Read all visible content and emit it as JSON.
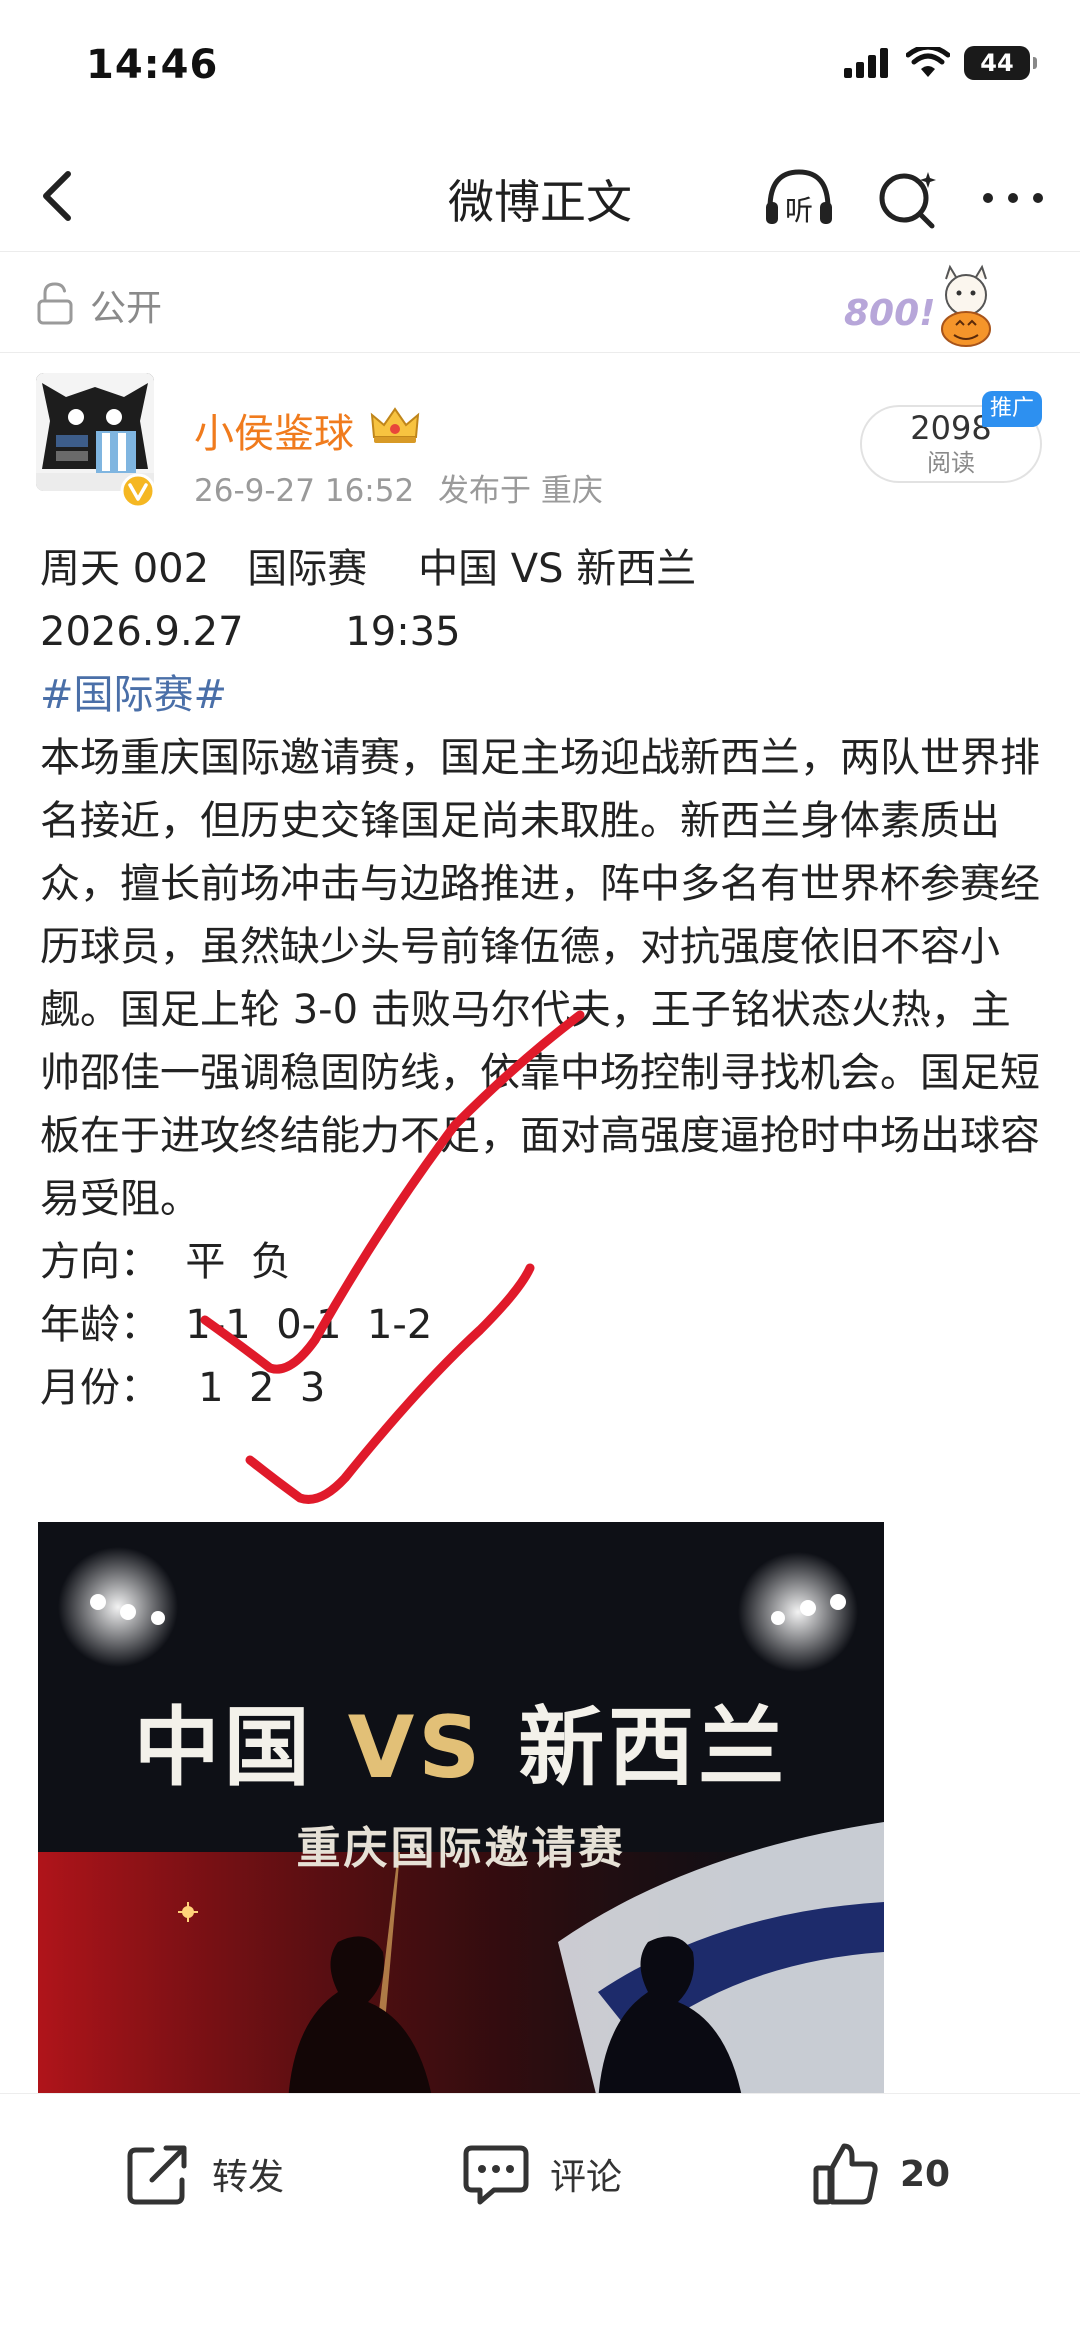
{
  "status_bar": {
    "time": "14:46",
    "battery": "44"
  },
  "nav": {
    "title": "微博正文",
    "listen_label": "听"
  },
  "visibility": {
    "label": "公开",
    "sticker_text": "800!"
  },
  "author": {
    "name": "小侯鉴球",
    "timestamp": "26-9-27 16:52",
    "location": "发布于 重庆",
    "reads_count": "2098",
    "reads_label": "阅读",
    "promo_badge": "推广"
  },
  "post": {
    "line1": "周天 002   国际赛    中国 VS 新西兰",
    "line2": "2026.9.27        19:35",
    "hashtag": "#国际赛#",
    "paragraph": "本场重庆国际邀请赛，国足主场迎战新西兰，两队世界排名接近，但历史交锋国足尚未取胜。新西兰身体素质出众，擅长前场冲击与边路推进，阵中多名有世界杯参赛经历球员，虽然缺少头号前锋伍德，对抗强度依旧不容小觑。国足上轮 3-0 击败马尔代夫，王子铭状态火热，主帅邵佳一强调稳固防线，依靠中场控制寻找机会。国足短板在于进攻终结能力不足，面对高强度逼抢时中场出球容易受阻。",
    "direction": "方向：  平  负",
    "age": "年龄：  1-1  0-1  1-2",
    "month": "月份：   1  2  3"
  },
  "image": {
    "title_left": "中国",
    "title_vs": "VS",
    "title_right": "新西兰",
    "subtitle": "重庆国际邀请赛"
  },
  "actions": {
    "repost": "转发",
    "comment": "评论",
    "like_count": "20"
  },
  "colors": {
    "author_orange": "#f07b1d",
    "hashtag_blue": "#4a6fa8",
    "promo_blue": "#2d90f0",
    "pen_red": "#e01a2a"
  }
}
